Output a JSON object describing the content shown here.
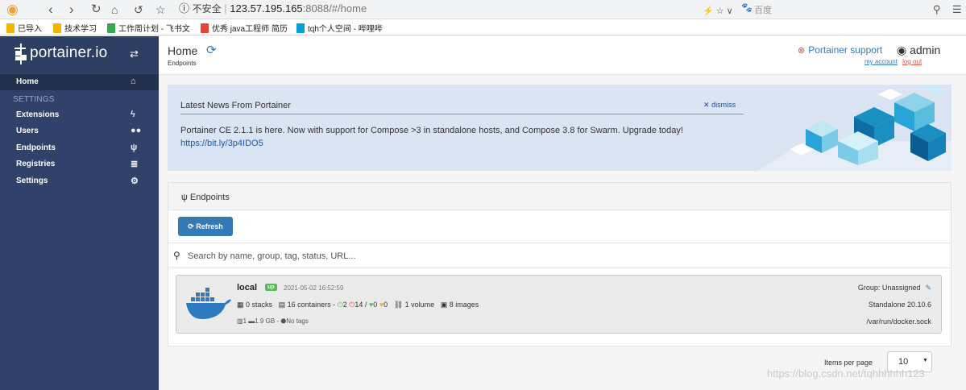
{
  "browser": {
    "security_label": "不安全",
    "url_host": "123.57.195.165",
    "url_rest": ":8088/#/home",
    "search_engine": "百度",
    "bookmarks": [
      {
        "label": "已导入",
        "color": "#f4b400"
      },
      {
        "label": "技术学习",
        "color": "#f4b400"
      },
      {
        "label": "工作周计划 - 飞书文",
        "color": "#34a853"
      },
      {
        "label": "优秀 java工程师 简历",
        "color": "#ea4335"
      },
      {
        "label": "tqh个人空间 - 哔哩哔",
        "color": "#00a1d6"
      }
    ]
  },
  "sidebar": {
    "brand": "portainer.io",
    "home_label": "Home",
    "settings_heading": "SETTINGS",
    "items": [
      {
        "label": "Extensions",
        "icon": "bolt-icon"
      },
      {
        "label": "Users",
        "icon": "users-icon"
      },
      {
        "label": "Endpoints",
        "icon": "plug-icon"
      },
      {
        "label": "Registries",
        "icon": "database-icon"
      },
      {
        "label": "Settings",
        "icon": "cogs-icon"
      }
    ]
  },
  "header": {
    "title": "Home",
    "breadcrumb": "Endpoints",
    "support_label": "Portainer support",
    "user": "admin",
    "my_account": "my account",
    "log_out": "log out"
  },
  "news": {
    "title": "Latest News From Portainer",
    "dismiss": "dismiss",
    "body": "Portainer CE 2.1.1 is here. Now with support for Compose >3 in standalone hosts, and Compose 3.8 for Swarm. Upgrade today!",
    "link": "https://bit.ly/3p4IDO5"
  },
  "endpoints": {
    "heading": "Endpoints",
    "refresh_label": "Refresh",
    "search_placeholder": "Search by name, group, tag, status, URL...",
    "items": [
      {
        "name": "local",
        "status": "up",
        "timestamp": "2021-05-02 16:52:59",
        "stacks": "0 stacks",
        "containers": "16 containers",
        "running": "2",
        "stopped": "14",
        "healthy": "0",
        "unhealthy": "0",
        "volumes": "1 volume",
        "images": "8 images",
        "cpu": "1",
        "memory": "1.9 GB",
        "tags": "No tags",
        "group": "Group: Unassigned",
        "version": "Standalone 20.10.6",
        "url": "/var/run/docker.sock"
      }
    ]
  },
  "pagination": {
    "items_per_page_label": "Items per page",
    "items_per_page": "10"
  },
  "watermark": "https://blog.csdn.net/tqhhhhhh123",
  "colors": {
    "sidebar": "#30426a",
    "primary": "#337ab7",
    "status_up": "#5cb85c",
    "news_bg": "#dbe4f2"
  }
}
